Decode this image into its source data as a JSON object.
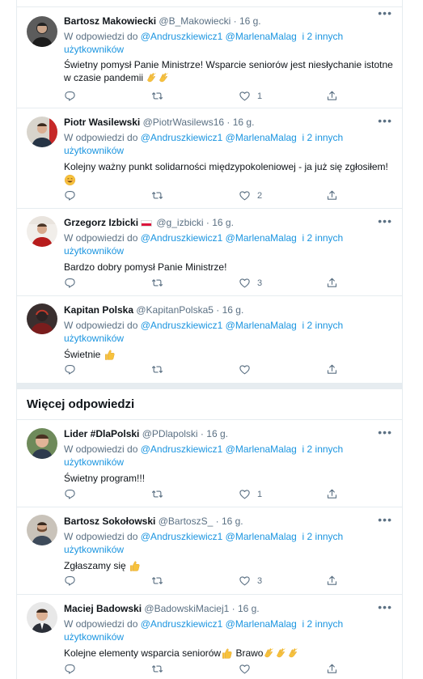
{
  "reply_prefix": "W odpowiedzi do",
  "reply_mention1": "@Andruszkiewicz1",
  "reply_mention2": "@MarlenaMalag",
  "reply_others_line1": "i 2 innych",
  "reply_others_line2": "użytkowników",
  "more_replies_title": "Więcej odpowiedzi",
  "tweets": [
    {
      "name": "Bartosz Makowiecki",
      "handle": "@B_Makowiecki",
      "time": "16 g.",
      "text": "Świetny pomysł Panie Ministrze! Wsparcie seniorów jest niesłychanie istotne w czasie pandemii",
      "likes": "1",
      "icons": {
        "emoji": "clapping-hands"
      }
    },
    {
      "name": "Piotr Wasilewski",
      "handle": "@PiotrWasilews16",
      "time": "16 g.",
      "text": "Kolejny ważny punkt solidarności międzypokoleniowej - ja już się zgłosiłem!",
      "likes": "2",
      "icons": {
        "emoji": "smiling-face"
      }
    },
    {
      "name": "Grzegorz Izbicki",
      "handle": "@g_izbicki",
      "time": "16 g.",
      "text": "Bardzo dobry pomysł Panie Ministrze!",
      "likes": "3",
      "icons": {
        "emoji": "polish-flag"
      }
    },
    {
      "name": "Kapitan Polska",
      "handle": "@KapitanPolska5",
      "time": "16 g.",
      "text": "Świetnie",
      "likes": "",
      "icons": {
        "emoji": "thumbs-up"
      }
    },
    {
      "name": "Lider #DlaPolski",
      "handle": "@PDlapolski",
      "time": "16 g.",
      "text": "Świetny program!!!",
      "likes": "1",
      "icons": {
        "emoji": ""
      }
    },
    {
      "name": "Bartosz Sokołowski",
      "handle": "@BartoszS_",
      "time": "16 g.",
      "text": "Zgłaszamy się",
      "likes": "3",
      "icons": {
        "emoji": "thumbs-up"
      }
    },
    {
      "name": "Maciej Badowski",
      "handle": "@BadowskiMaciej1",
      "time": "16 g.",
      "text": "Kolejne elementy wsparcia seniorów",
      "text2": "Brawo",
      "likes": "",
      "icons": {
        "emoji": "thumbs-up, clapping-hands"
      }
    }
  ],
  "colors": {
    "link": "#1b95e0",
    "muted": "#5b7083",
    "border": "#e6ecf0"
  }
}
